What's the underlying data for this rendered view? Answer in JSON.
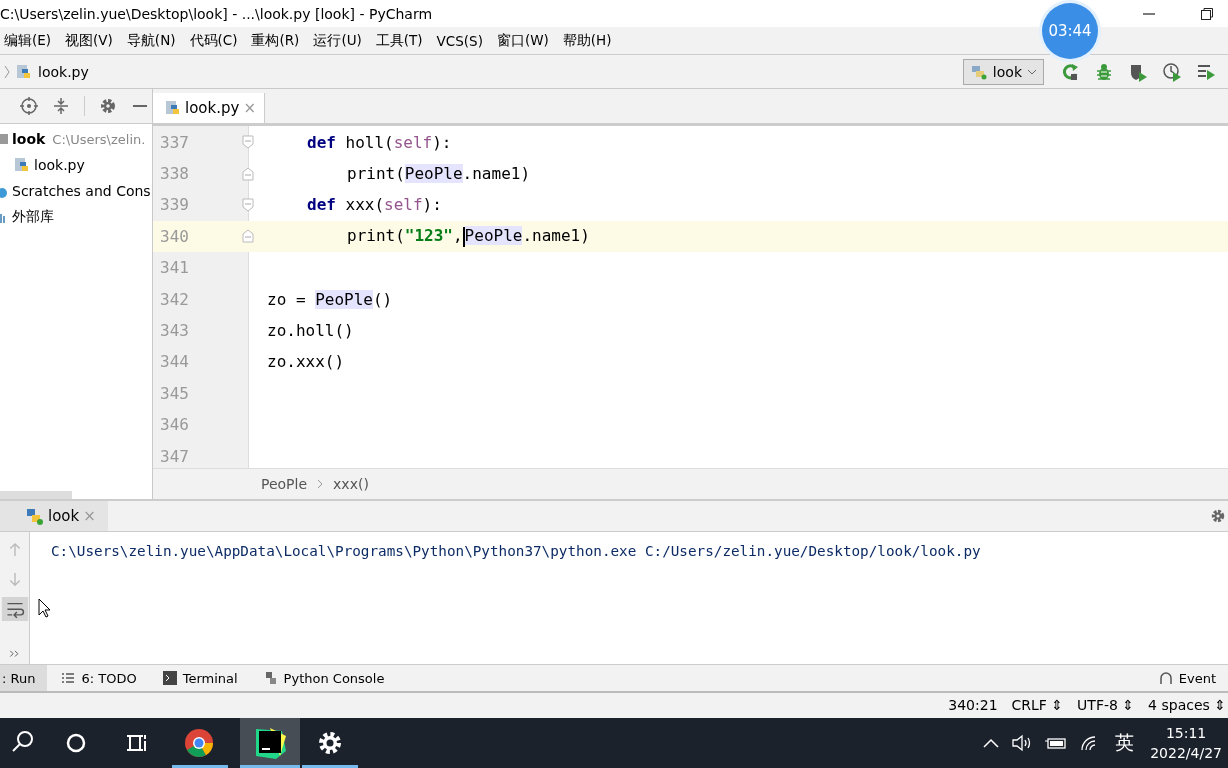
{
  "window": {
    "title": "C:\\Users\\zelin.yue\\Desktop\\look] - ...\\look.py [look] - PyCharm"
  },
  "recorder_timer": "03:44",
  "menu": [
    "编辑(E)",
    "视图(V)",
    "导航(N)",
    "代码(C)",
    "重构(R)",
    "运行(U)",
    "工具(T)",
    "VCS(S)",
    "窗口(W)",
    "帮助(H)"
  ],
  "nav_bar": {
    "file": "look.py",
    "run_config": "look"
  },
  "project_tree": [
    {
      "name": "look",
      "path": "C:\\Users\\zelin.",
      "kind": "folder",
      "children": [
        {
          "name": "look.py",
          "kind": "python"
        }
      ]
    },
    {
      "name": "Scratches and Cons",
      "kind": "scratches"
    },
    {
      "name": "外部库",
      "kind": "library"
    }
  ],
  "editor_tabs": [
    {
      "label": "look.py",
      "selected": true,
      "close": "×"
    }
  ],
  "code_lines": [
    {
      "number": "337",
      "kind": "def",
      "current": false,
      "tokens": [
        {
          "text": "def",
          "kind": "keyword"
        },
        {
          "text": " holl(",
          "kind": "plain"
        },
        {
          "text": "self",
          "kind": "self"
        },
        {
          "text": "):",
          "kind": "plain"
        }
      ]
    },
    {
      "number": "338",
      "kind": "body",
      "current": false,
      "tokens": [
        {
          "text": "print(",
          "kind": "plain"
        },
        {
          "text": "PeoPle",
          "kind": "usage"
        },
        {
          "text": ".name1)",
          "kind": "plain"
        }
      ]
    },
    {
      "number": "339",
      "kind": "def",
      "current": false,
      "tokens": [
        {
          "text": "def",
          "kind": "keyword"
        },
        {
          "text": " xxx(",
          "kind": "plain"
        },
        {
          "text": "self",
          "kind": "self"
        },
        {
          "text": "):",
          "kind": "plain"
        }
      ]
    },
    {
      "number": "340",
      "kind": "body",
      "current": true,
      "tokens": [
        {
          "text": "print(",
          "kind": "plain"
        },
        {
          "text": "\"123\"",
          "kind": "string"
        },
        {
          "text": ",",
          "kind": "plain"
        },
        {
          "text": "PeoPle",
          "kind": "usage",
          "caret": true
        },
        {
          "text": ".name1)",
          "kind": "plain"
        }
      ]
    },
    {
      "number": "341",
      "kind": "top",
      "current": false
    },
    {
      "number": "342",
      "kind": "top",
      "current": false,
      "tokens": [
        {
          "text": "zo = ",
          "kind": "plain"
        },
        {
          "text": "PeoPle",
          "kind": "usage"
        },
        {
          "text": "()",
          "kind": "plain"
        }
      ]
    },
    {
      "number": "343",
      "kind": "top",
      "current": false,
      "tokens": [
        {
          "text": "zo.holl()",
          "kind": "plain"
        }
      ]
    },
    {
      "number": "344",
      "kind": "top",
      "current": false,
      "tokens": [
        {
          "text": "zo.xxx()",
          "kind": "plain"
        }
      ]
    },
    {
      "number": "345",
      "kind": "top",
      "current": false
    },
    {
      "number": "346",
      "kind": "top",
      "current": false
    },
    {
      "number": "347",
      "kind": "top",
      "current": false
    }
  ],
  "breadcrumb": [
    "PeoPle",
    "xxx()"
  ],
  "run_panel": {
    "tab": "look",
    "close": "×",
    "output": "C:\\Users\\zelin.yue\\AppData\\Local\\Programs\\Python\\Python37\\python.exe C:/Users/zelin.yue/Desktop/look/look.py"
  },
  "tool_tabs": [
    {
      "label": ": Run",
      "selected": true,
      "kind": "run"
    },
    {
      "label": "6: TODO",
      "selected": false,
      "kind": "todo"
    },
    {
      "label": "Terminal",
      "selected": false,
      "kind": "terminal"
    },
    {
      "label": "Python Console",
      "selected": false,
      "kind": "console"
    }
  ],
  "event_log": "Event",
  "status_bar": [
    "340:21",
    "CRLF ⇕",
    "UTF-8 ⇕",
    "4 spaces ⇕"
  ],
  "taskbar": {
    "time": "15:11",
    "date": "2022/4/27",
    "ime": "英"
  }
}
